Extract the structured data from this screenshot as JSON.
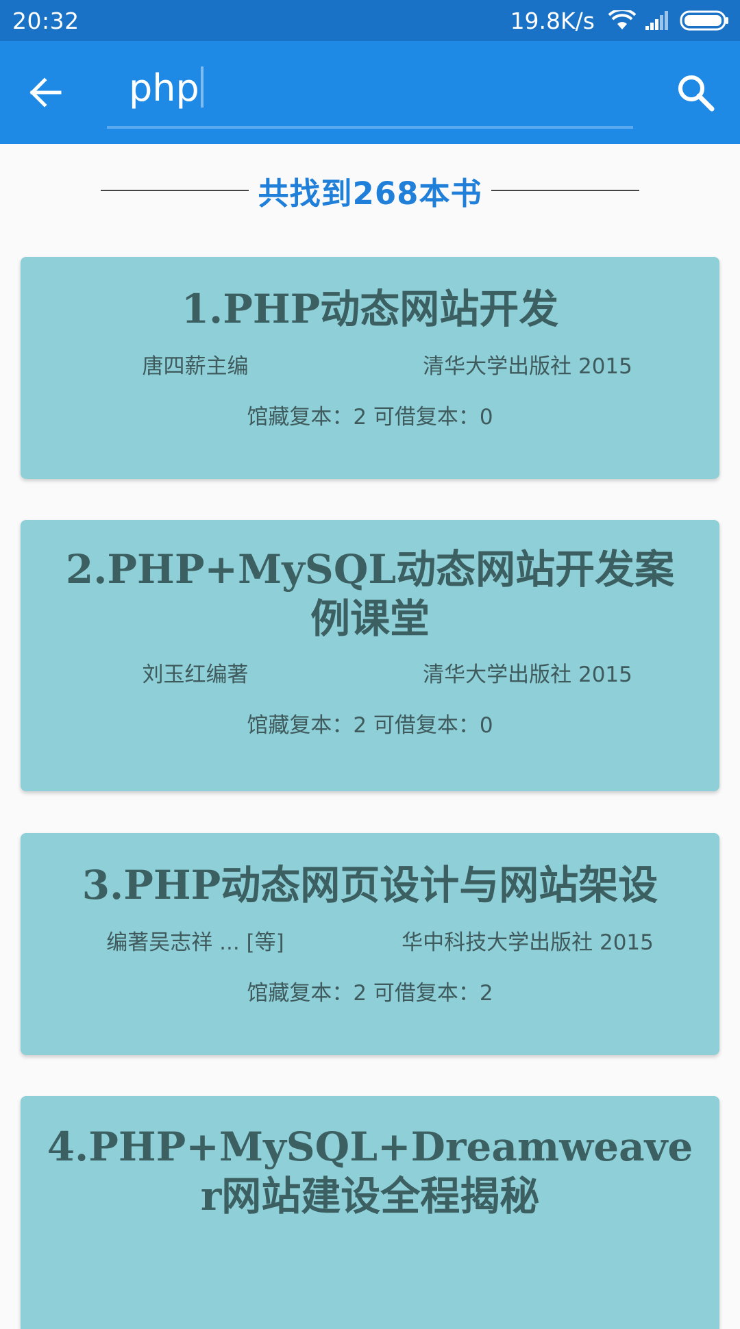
{
  "status_bar": {
    "time": "20:32",
    "network_speed": "19.8K/s",
    "icons": [
      "wifi-icon",
      "signal-icon",
      "battery-icon"
    ]
  },
  "toolbar": {
    "search_value": "php",
    "back_icon": "arrow-back-icon",
    "search_icon": "search-icon"
  },
  "results": {
    "summary": "共找到268本书"
  },
  "books": [
    {
      "title": "1.PHP动态网站开发",
      "author": "唐四薪主编",
      "publisher": "清华大学出版社 2015",
      "copies": "馆藏复本：2 可借复本：0"
    },
    {
      "title": "2.PHP+MySQL动态网站开发案例课堂",
      "author": "刘玉红编著",
      "publisher": "清华大学出版社 2015",
      "copies": "馆藏复本：2 可借复本：0"
    },
    {
      "title": "3.PHP动态网页设计与网站架设",
      "author": "编著吴志祥 ... [等]",
      "publisher": "华中科技大学出版社 2015",
      "copies": "馆藏复本：2 可借复本：2"
    },
    {
      "title": "4.PHP+MySQL+Dreamweaver网站建设全程揭秘"
    }
  ],
  "colors": {
    "status_bar": "#1a72c7",
    "toolbar": "#1f8ae6",
    "card": "#8fd0d8",
    "card_title": "#3c5f61",
    "summary": "#1f7fd9",
    "background": "#fafafa"
  }
}
